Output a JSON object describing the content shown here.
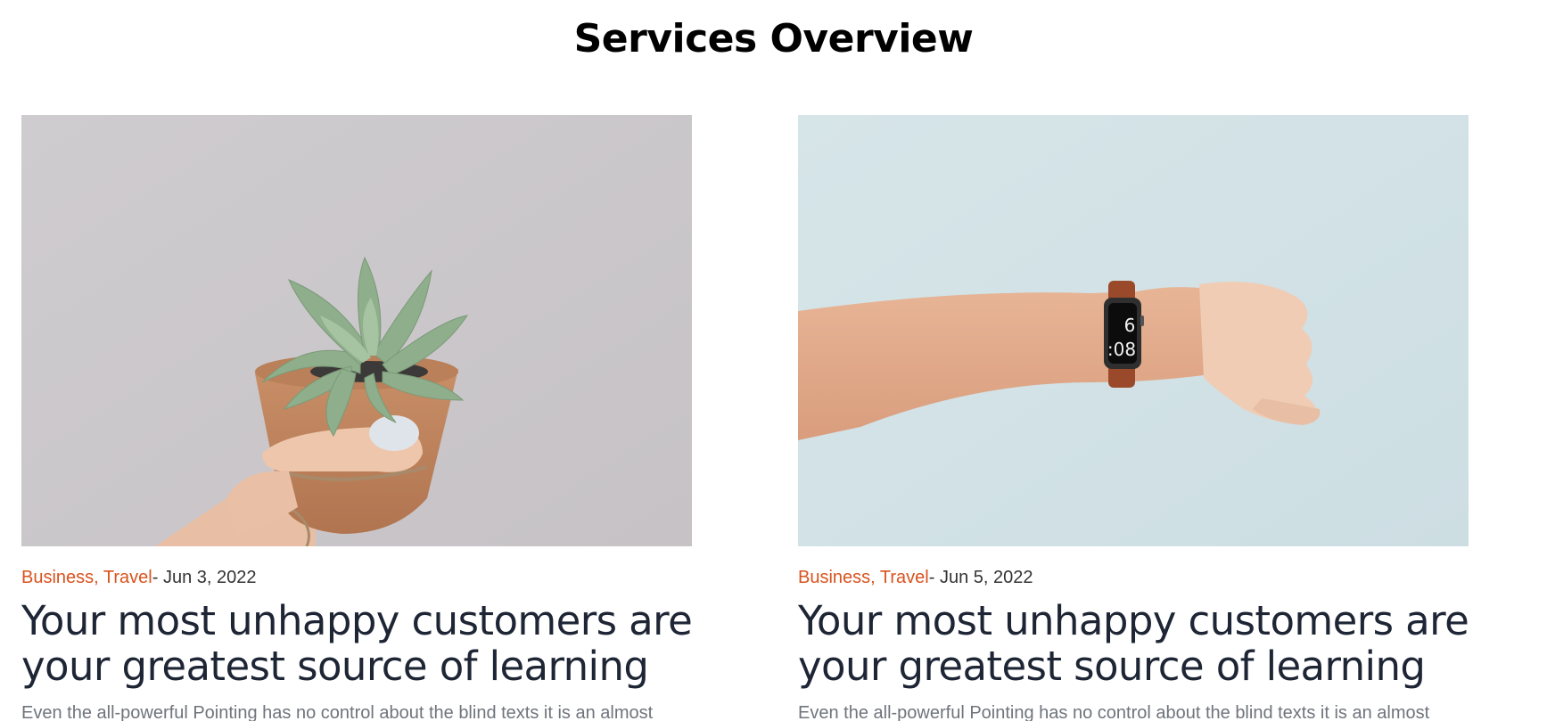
{
  "section": {
    "title": "Services Overview"
  },
  "cards": [
    {
      "image_subject": "hand holding a succulent in a terracotta pot",
      "categories": "Business, Travel",
      "date": "- Jun 3, 2022",
      "title": "Your most unhappy customers are your greatest source of learning",
      "excerpt": "Even the all-powerful Pointing has no control about the blind texts it is an almost"
    },
    {
      "image_subject": "outstretched arm wearing a smartwatch",
      "watch_time_hour": "6",
      "watch_time_minutes": ":08",
      "categories": "Business, Travel",
      "date": "- Jun 5, 2022",
      "title": "Your most unhappy customers are your greatest source of learning",
      "excerpt": "Even the all-powerful Pointing has no control about the blind texts it is an almost"
    }
  ],
  "colors": {
    "category_accent": "#d9531e",
    "title_text": "#1e2535",
    "excerpt_text": "#6f747c",
    "image1_background": "#cbc8cc",
    "image2_background": "#d2e2e6"
  }
}
